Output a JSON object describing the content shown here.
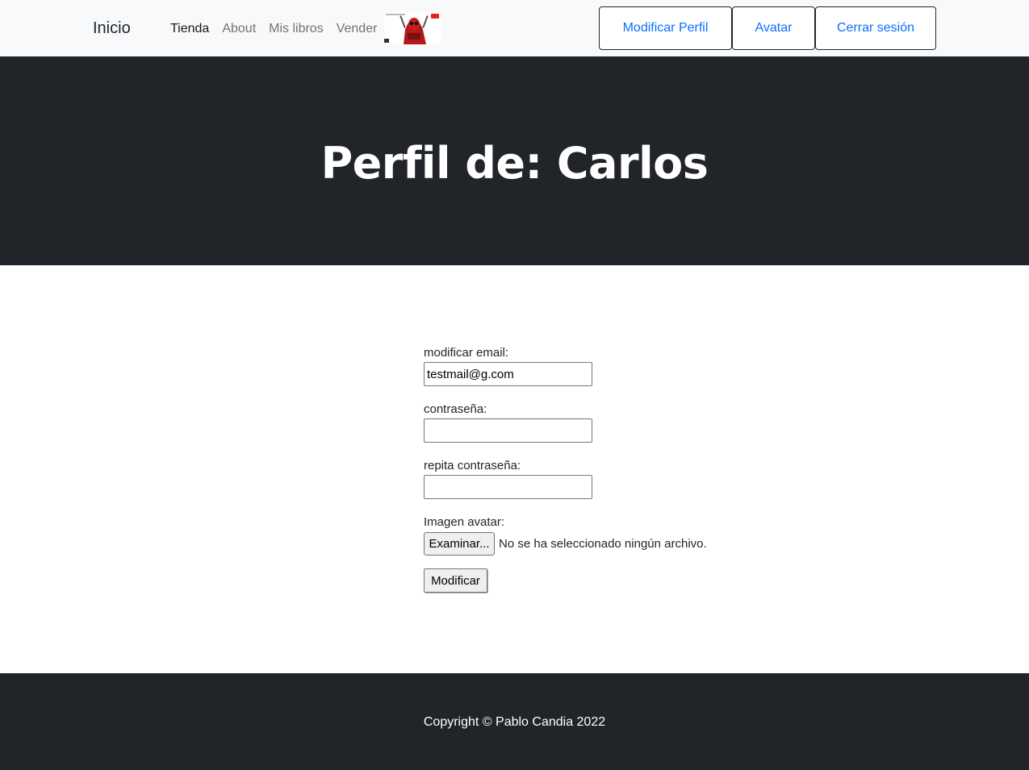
{
  "navbar": {
    "brand": "Inicio",
    "links": [
      {
        "label": "Tienda",
        "active": true
      },
      {
        "label": "About",
        "active": false
      },
      {
        "label": "Mis libros",
        "active": false
      },
      {
        "label": "Vender",
        "active": false
      }
    ],
    "buttons": {
      "modify_profile": "Modificar Perfil",
      "avatar": "Avatar",
      "logout": "Cerrar sesión"
    },
    "accent_color": "#0d6efd"
  },
  "header": {
    "title": "Perfil de: Carlos",
    "background": "#212529"
  },
  "form": {
    "email": {
      "label": "modificar email:",
      "value": "testmail@g.com"
    },
    "password": {
      "label": "contraseña:",
      "value": ""
    },
    "password_repeat": {
      "label": "repita contraseña:",
      "value": ""
    },
    "avatar": {
      "label": "Imagen avatar:",
      "button": "Examinar...",
      "status": "No se ha seleccionado ningún archivo."
    },
    "submit": "Modificar"
  },
  "footer": {
    "copyright": "Copyright © Pablo Candia 2022"
  }
}
